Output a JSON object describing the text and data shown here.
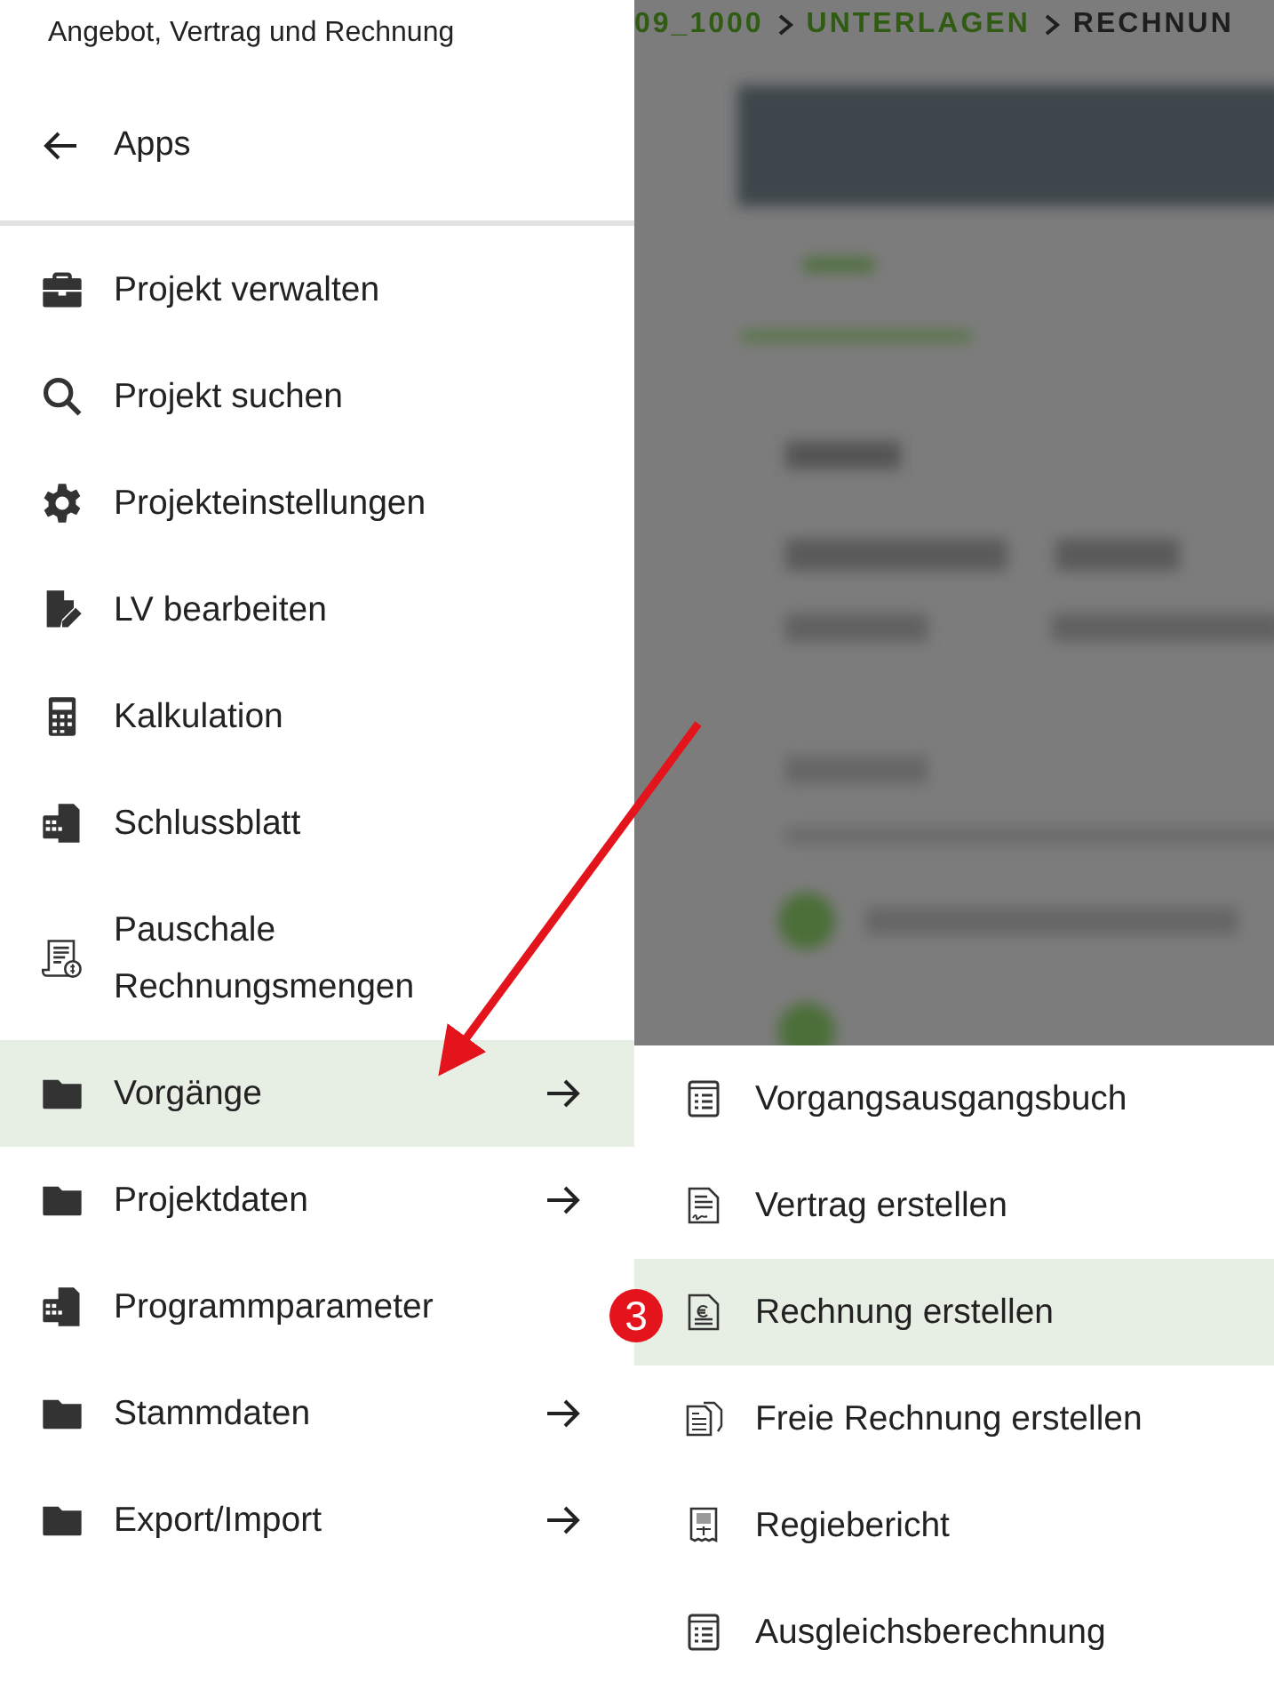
{
  "drawer": {
    "title": "Angebot, Vertrag und Rechnung",
    "back": {
      "label": "Apps"
    },
    "items": [
      {
        "label": "Projekt verwalten",
        "selected": false,
        "has_submenu": false
      },
      {
        "label": "Projekt suchen",
        "selected": false,
        "has_submenu": false
      },
      {
        "label": "Projekteinstellungen",
        "selected": false,
        "has_submenu": false
      },
      {
        "label": "LV bearbeiten",
        "selected": false,
        "has_submenu": false
      },
      {
        "label": "Kalkulation",
        "selected": false,
        "has_submenu": false
      },
      {
        "label": "Schlussblatt",
        "selected": false,
        "has_submenu": false
      },
      {
        "label": "Pauschale Rechnungsmengen",
        "selected": false,
        "has_submenu": false
      },
      {
        "label": "Vorgänge",
        "selected": true,
        "has_submenu": true
      },
      {
        "label": "Projektdaten",
        "selected": false,
        "has_submenu": true
      },
      {
        "label": "Programmparameter",
        "selected": false,
        "has_submenu": false
      },
      {
        "label": "Stammdaten",
        "selected": false,
        "has_submenu": true
      },
      {
        "label": "Export/Import",
        "selected": false,
        "has_submenu": true
      }
    ]
  },
  "breadcrumb": [
    {
      "label": "09_1000",
      "current": false
    },
    {
      "label": "UNTERLAGEN",
      "current": false
    },
    {
      "label": "RECHNUN",
      "current": true
    }
  ],
  "submenu": {
    "items": [
      {
        "label": "Vorgangsausgangsbuch",
        "selected": false
      },
      {
        "label": "Vertrag erstellen",
        "selected": false
      },
      {
        "label": "Rechnung erstellen",
        "selected": true
      },
      {
        "label": "Freie Rechnung erstellen",
        "selected": false
      },
      {
        "label": "Regiebericht",
        "selected": false
      },
      {
        "label": "Ausgleichsberechnung",
        "selected": false
      }
    ]
  },
  "annotation": {
    "badge": "3"
  }
}
